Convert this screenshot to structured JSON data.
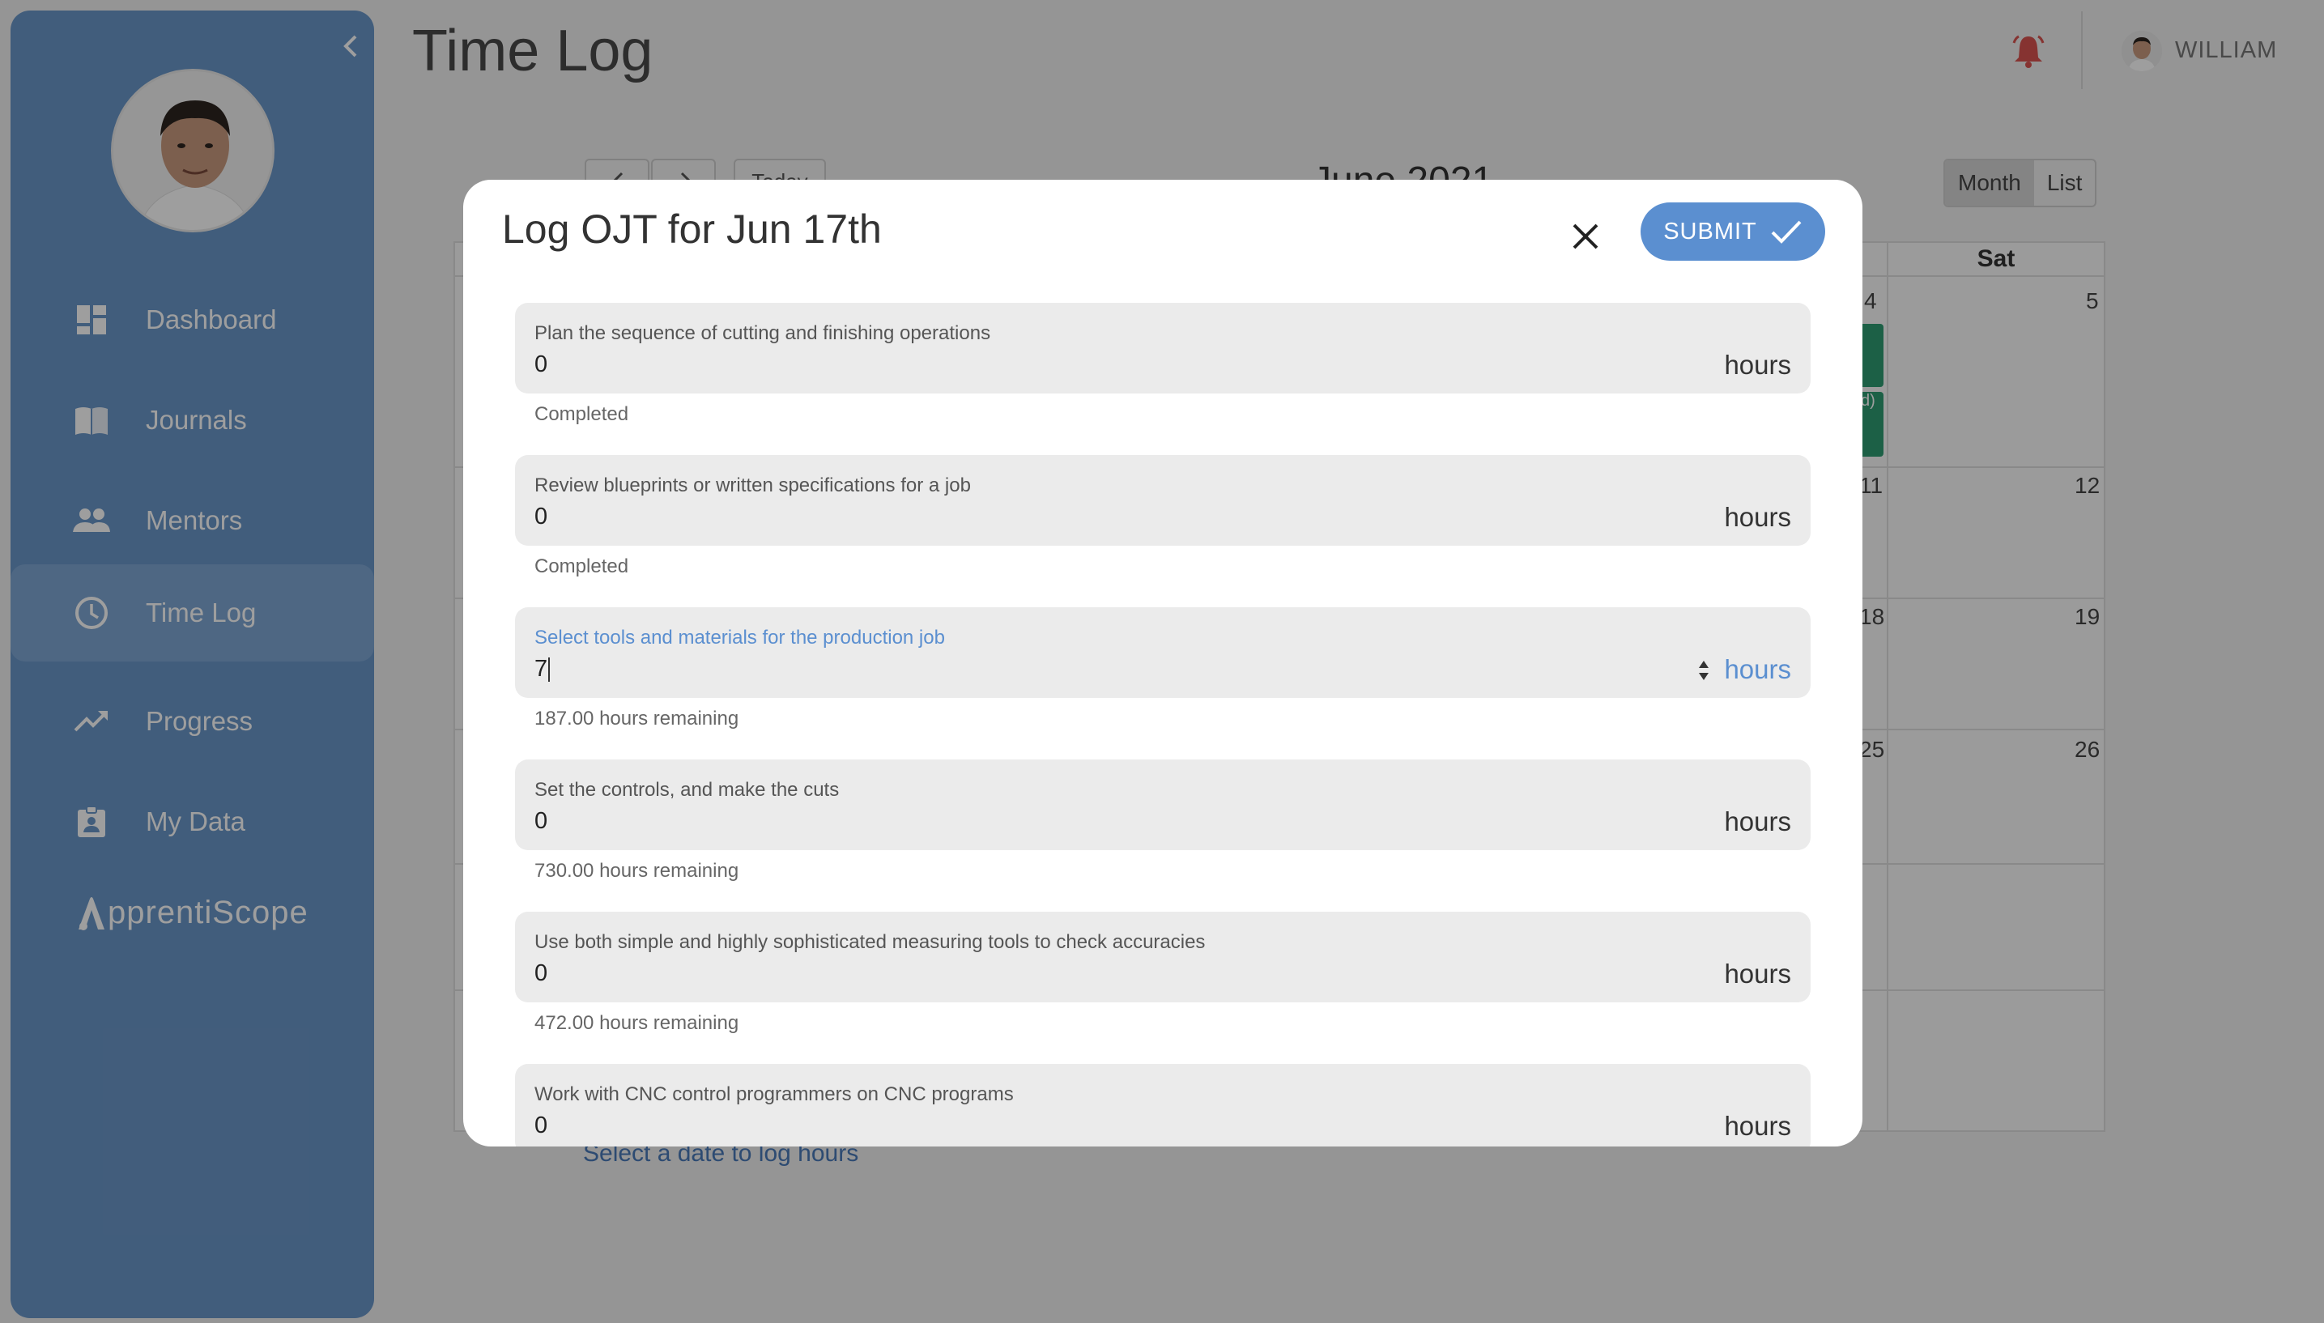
{
  "sidebar": {
    "items": [
      {
        "label": "Dashboard",
        "icon": "dashboard-icon"
      },
      {
        "label": "Journals",
        "icon": "book-icon"
      },
      {
        "label": "Mentors",
        "icon": "people-icon"
      },
      {
        "label": "Time Log",
        "icon": "clock-icon",
        "active": true
      },
      {
        "label": "Progress",
        "icon": "trending-up-icon"
      },
      {
        "label": "My Data",
        "icon": "badge-icon"
      }
    ],
    "logo_text": "pprentiScope"
  },
  "header": {
    "title": "Time Log",
    "user_name": "WILLIAM"
  },
  "calendar": {
    "today_label": "Today",
    "month_title": "June 2021",
    "view_month": "Month",
    "view_list": "List",
    "sat_header": "Sat",
    "days": {
      "d4": "4",
      "d5": "5",
      "d11": "11",
      "d12": "12",
      "d18": "18",
      "d19": "19",
      "d25": "25",
      "d26": "26"
    },
    "event_fragment": "d)",
    "footer_hint": "Select a date to log hours"
  },
  "modal": {
    "title": "Log OJT for Jun 17th",
    "submit_label": "SUBMIT",
    "unit": "hours",
    "tasks": [
      {
        "label": "Plan the sequence of cutting and finishing operations",
        "value": "0",
        "hint": "Completed"
      },
      {
        "label": "Review blueprints or written specifications for a job",
        "value": "0",
        "hint": "Completed"
      },
      {
        "label": "Select tools and materials for the production job",
        "value": "7",
        "hint": "187.00 hours remaining"
      },
      {
        "label": "Set the controls, and make the cuts",
        "value": "0",
        "hint": "730.00 hours remaining"
      },
      {
        "label": "Use both simple and highly sophisticated measuring tools to check accuracies",
        "value": "0",
        "hint": "472.00 hours remaining"
      },
      {
        "label": "Work with CNC control programmers on CNC programs",
        "value": "0",
        "hint": ""
      }
    ]
  },
  "colors": {
    "accent": "#5b8fd0",
    "sidebar": "#6a96c8",
    "event": "#2e9c72",
    "bell": "#d9534f"
  }
}
